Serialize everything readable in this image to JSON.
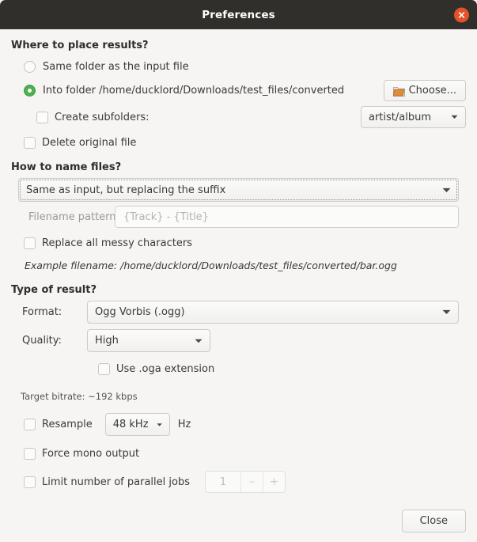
{
  "window": {
    "title": "Preferences",
    "close_icon": "close-icon"
  },
  "sections": {
    "where": {
      "heading": "Where to place results?",
      "radio_same_folder": "Same folder as the input file",
      "radio_into_folder": "Into folder /home/ducklord/Downloads/test_files/converted",
      "choose_button": "Choose...",
      "create_subfolders": "Create subfolders:",
      "subfolder_pattern": "artist/album",
      "delete_original": "Delete original file"
    },
    "naming": {
      "heading": "How to name files?",
      "scheme": "Same as input, but replacing the suffix",
      "pattern_label": "Filename pattern:",
      "pattern_placeholder": "{Track} - {Title}",
      "pattern_value": "{Track} - {Title}",
      "replace_messy": "Replace all messy characters",
      "example_label": "Example filename:",
      "example_path": "/home/ducklord/Downloads/test_files/converted/bar.ogg"
    },
    "result": {
      "heading": "Type of result?",
      "format_label": "Format:",
      "format_value": "Ogg Vorbis (.ogg)",
      "quality_label": "Quality:",
      "quality_value": "High",
      "use_oga": "Use .oga extension",
      "bitrate_hint": "Target bitrate: ~192 kbps",
      "resample_label": "Resample",
      "resample_value": "48 kHz",
      "hz_label": "Hz",
      "force_mono": "Force mono output",
      "limit_jobs": "Limit number of parallel jobs",
      "jobs_value": "1",
      "jobs_minus": "–",
      "jobs_plus": "+"
    }
  },
  "footer": {
    "close_label": "Close"
  },
  "colors": {
    "titlebar": "#302f2c",
    "close_red": "#e2522b",
    "radio_green": "#4caf50",
    "background": "#f6f5f4"
  }
}
